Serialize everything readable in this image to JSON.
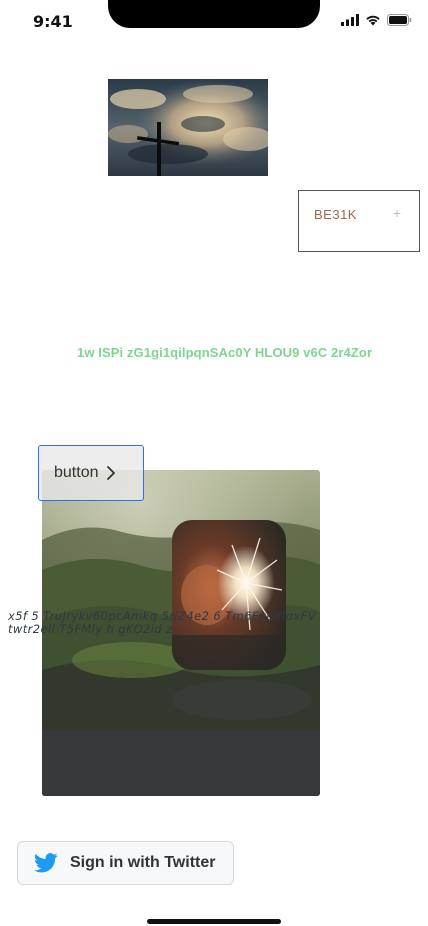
{
  "status_bar": {
    "time": "9:41",
    "icons": [
      "cellular-signal-icon",
      "wifi-icon",
      "battery-icon"
    ]
  },
  "images": {
    "top": "clouds-cross-photo",
    "main": "misty-forest-photo",
    "card": "sparkler-photo"
  },
  "chip": {
    "label": "BE31K",
    "action_symbol": "+"
  },
  "green_text": "1w ISPi zG1gi1qilpqnSAc0Y HLOU9  v6C 2r4Zor",
  "outline_button": {
    "label": "button",
    "icon": "chevron-right-icon"
  },
  "italic_text": "x5f 5 TruJrykv60pcAmkq 5rIZ4e2 6 Tm6FypdfoxFVtwtr2eil T5FMly h gKO2id z",
  "twitter_button": {
    "label": "Sign in with Twitter",
    "icon": "twitter-bird-icon"
  },
  "colors": {
    "green_text": "#7dd68f",
    "chip_text": "#a0674a",
    "button_border": "#2f6bff",
    "twitter_blue": "#1d9bf0"
  }
}
